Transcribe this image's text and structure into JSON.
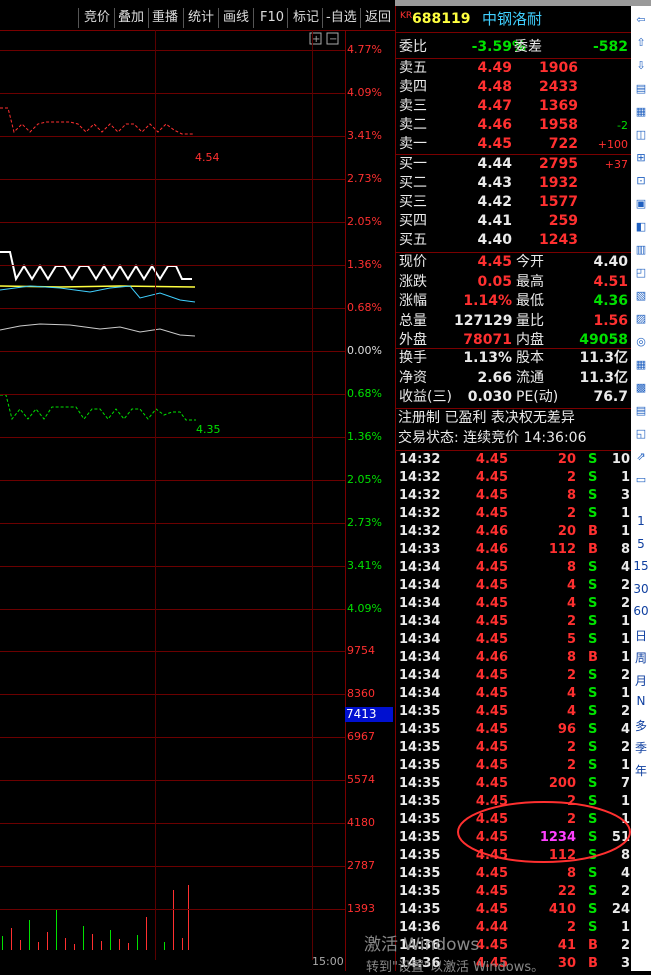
{
  "toolbar": {
    "items": [
      "竞价",
      "叠加",
      "重播",
      "统计",
      "画线",
      "F10",
      "标记",
      "-自选",
      "返回"
    ]
  },
  "chart": {
    "price_axis_top": [
      "4.77%",
      "4.09%",
      "3.41%",
      "2.73%",
      "2.05%",
      "1.36%",
      "0.68%",
      "0.00%"
    ],
    "price_axis_bottom": [
      "0.68%",
      "1.36%",
      "2.05%",
      "2.73%",
      "3.41%",
      "4.09%"
    ],
    "volume_axis": [
      "9754",
      "8360",
      "6967",
      "5574",
      "4180",
      "2787",
      "1393"
    ],
    "volume_current": "7413",
    "price_annotation_high": "4.54",
    "price_annotation_low": "4.35",
    "time_label": "15:00",
    "colors": {
      "up": "#ff3030",
      "down": "#00e000",
      "grid": "#6b0000",
      "price_line": "#ffffff",
      "avg_line": "#ffff40"
    }
  },
  "header": {
    "badge": "KR",
    "code": "688119",
    "name": "中钢洛耐"
  },
  "order_ratio": {
    "label1": "委比",
    "value1": "-3.59%",
    "label2": "委差",
    "value2": "-582"
  },
  "sells": [
    {
      "label": "卖五",
      "price": "4.49",
      "vol": "1906",
      "chg": ""
    },
    {
      "label": "卖四",
      "price": "4.48",
      "vol": "2433",
      "chg": ""
    },
    {
      "label": "卖三",
      "price": "4.47",
      "vol": "1369",
      "chg": ""
    },
    {
      "label": "卖二",
      "price": "4.46",
      "vol": "1958",
      "chg": "-2"
    },
    {
      "label": "卖一",
      "price": "4.45",
      "vol": "722",
      "chg": "+100"
    }
  ],
  "buys": [
    {
      "label": "买一",
      "price": "4.44",
      "vol": "2795",
      "chg": "+37"
    },
    {
      "label": "买二",
      "price": "4.43",
      "vol": "1932",
      "chg": ""
    },
    {
      "label": "买三",
      "price": "4.42",
      "vol": "1577",
      "chg": ""
    },
    {
      "label": "买四",
      "price": "4.41",
      "vol": "259",
      "chg": ""
    },
    {
      "label": "买五",
      "price": "4.40",
      "vol": "1243",
      "chg": ""
    }
  ],
  "quote": [
    {
      "l1": "现价",
      "v1": "4.45",
      "l2": "今开",
      "v2": "4.40"
    },
    {
      "l1": "涨跌",
      "v1": "0.05",
      "l2": "最高",
      "v2": "4.51"
    },
    {
      "l1": "涨幅",
      "v1": "1.14%",
      "l2": "最低",
      "v2": "4.36"
    },
    {
      "l1": "总量",
      "v1": "127129",
      "l2": "量比",
      "v2": "1.56"
    },
    {
      "l1": "外盘",
      "v1": "78071",
      "l2": "内盘",
      "v2": "49058"
    }
  ],
  "fundamentals": [
    {
      "l1": "换手",
      "v1": "1.13%",
      "l2": "股本",
      "v2": "11.3亿"
    },
    {
      "l1": "净资",
      "v1": "2.66",
      "l2": "流通",
      "v2": "11.3亿"
    },
    {
      "l1": "收益(三)",
      "v1": "0.030",
      "l2": "PE(动)",
      "v2": "76.7"
    }
  ],
  "notice": "注册制 已盈利 表决权无差异",
  "trade_status": "交易状态: 连续竞价 14:36:06",
  "ticks": [
    {
      "t": "14:32",
      "p": "4.45",
      "v": "20",
      "bs": "S",
      "n": "10"
    },
    {
      "t": "14:32",
      "p": "4.45",
      "v": "2",
      "bs": "S",
      "n": "1"
    },
    {
      "t": "14:32",
      "p": "4.45",
      "v": "8",
      "bs": "S",
      "n": "3"
    },
    {
      "t": "14:32",
      "p": "4.45",
      "v": "2",
      "bs": "S",
      "n": "1"
    },
    {
      "t": "14:32",
      "p": "4.46",
      "v": "20",
      "bs": "B",
      "n": "1"
    },
    {
      "t": "14:33",
      "p": "4.46",
      "v": "112",
      "bs": "B",
      "n": "8"
    },
    {
      "t": "14:34",
      "p": "4.45",
      "v": "8",
      "bs": "S",
      "n": "4"
    },
    {
      "t": "14:34",
      "p": "4.45",
      "v": "4",
      "bs": "S",
      "n": "2"
    },
    {
      "t": "14:34",
      "p": "4.45",
      "v": "4",
      "bs": "S",
      "n": "2"
    },
    {
      "t": "14:34",
      "p": "4.45",
      "v": "2",
      "bs": "S",
      "n": "1"
    },
    {
      "t": "14:34",
      "p": "4.45",
      "v": "5",
      "bs": "S",
      "n": "1"
    },
    {
      "t": "14:34",
      "p": "4.46",
      "v": "8",
      "bs": "B",
      "n": "1"
    },
    {
      "t": "14:34",
      "p": "4.45",
      "v": "2",
      "bs": "S",
      "n": "2"
    },
    {
      "t": "14:34",
      "p": "4.45",
      "v": "4",
      "bs": "S",
      "n": "1"
    },
    {
      "t": "14:35",
      "p": "4.45",
      "v": "4",
      "bs": "S",
      "n": "2"
    },
    {
      "t": "14:35",
      "p": "4.45",
      "v": "96",
      "bs": "S",
      "n": "4"
    },
    {
      "t": "14:35",
      "p": "4.45",
      "v": "2",
      "bs": "S",
      "n": "2"
    },
    {
      "t": "14:35",
      "p": "4.45",
      "v": "2",
      "bs": "S",
      "n": "1"
    },
    {
      "t": "14:35",
      "p": "4.45",
      "v": "200",
      "bs": "S",
      "n": "7"
    },
    {
      "t": "14:35",
      "p": "4.45",
      "v": "2",
      "bs": "S",
      "n": "1"
    },
    {
      "t": "14:35",
      "p": "4.45",
      "v": "2",
      "bs": "S",
      "n": "1"
    },
    {
      "t": "14:35",
      "p": "4.45",
      "v": "1234",
      "bs": "S",
      "n": "51"
    },
    {
      "t": "14:35",
      "p": "4.45",
      "v": "112",
      "bs": "S",
      "n": "8"
    },
    {
      "t": "14:35",
      "p": "4.45",
      "v": "8",
      "bs": "S",
      "n": "4"
    },
    {
      "t": "14:35",
      "p": "4.45",
      "v": "22",
      "bs": "S",
      "n": "2"
    },
    {
      "t": "14:35",
      "p": "4.45",
      "v": "410",
      "bs": "S",
      "n": "24"
    },
    {
      "t": "14:36",
      "p": "4.44",
      "v": "2",
      "bs": "S",
      "n": "1"
    },
    {
      "t": "14:36",
      "p": "4.45",
      "v": "41",
      "bs": "B",
      "n": "2"
    },
    {
      "t": "14:36",
      "p": "4.45",
      "v": "30",
      "bs": "B",
      "n": "3"
    }
  ],
  "side_periods": [
    "1",
    "5",
    "15",
    "30",
    "60",
    "日",
    "周",
    "月",
    "N",
    "多",
    "季",
    "年"
  ],
  "watermark": {
    "line1": "激活 Windows",
    "line2": "转到\"设置\"以激活 Windows。"
  }
}
